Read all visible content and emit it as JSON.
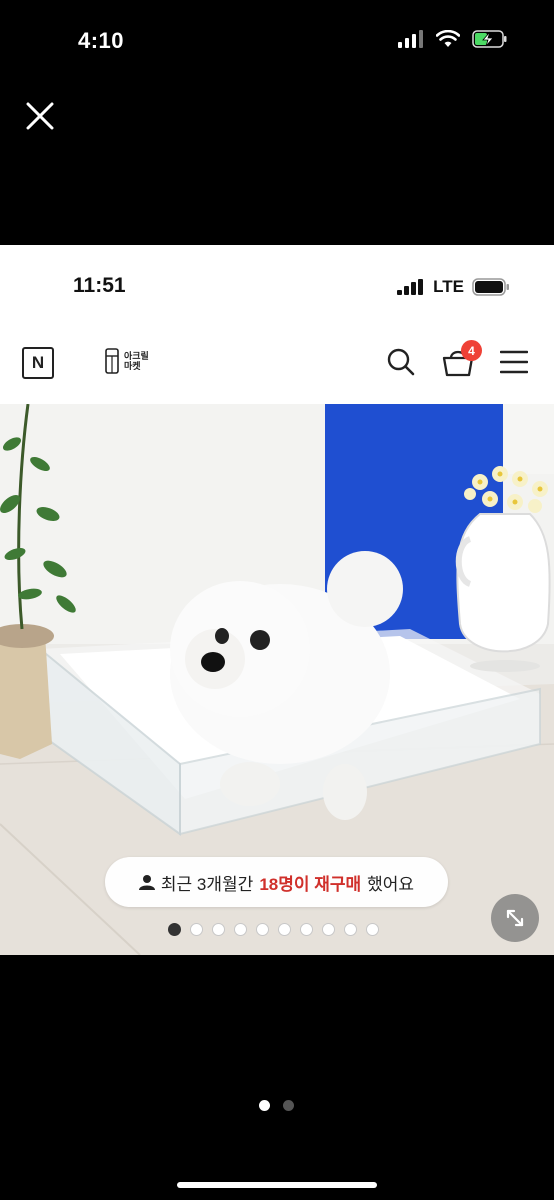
{
  "outer_status": {
    "time": "4:10"
  },
  "inner_status": {
    "time": "11:51",
    "network": "LTE"
  },
  "header": {
    "logo_letter": "N",
    "brand_line1": "아크릴",
    "brand_line2": "마켓",
    "cart_count": "4"
  },
  "banner": {
    "prefix": "최근 3개월간",
    "highlight": "18명이 재구매",
    "suffix": "했어요"
  },
  "carousel": {
    "total": 10,
    "active": 0
  },
  "pager": {
    "total": 2,
    "active": 0
  },
  "colors": {
    "badge": "#ef4136",
    "highlight": "#d0302b",
    "wall_panel": "#1f4fd1"
  }
}
